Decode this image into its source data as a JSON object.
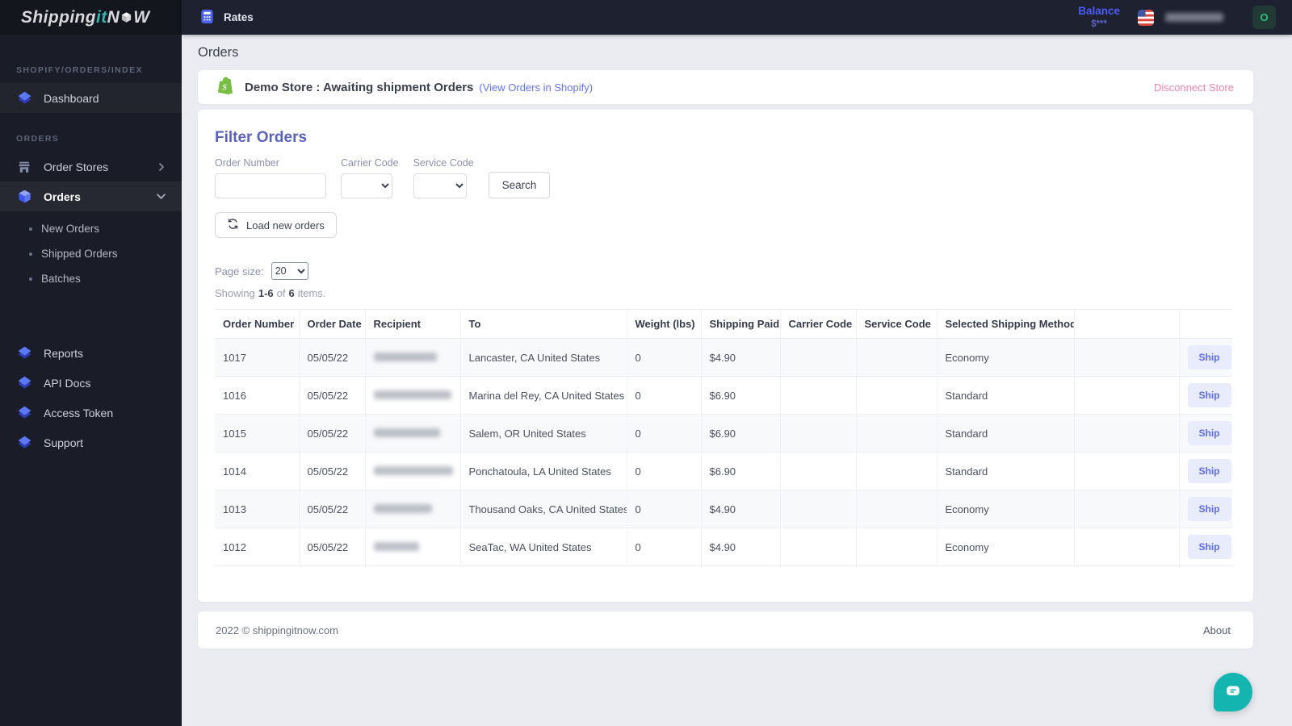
{
  "sidebar": {
    "logo": {
      "part1": "Shipping",
      "part2": "it",
      "part3": "N",
      "part4": "W"
    },
    "section_shopify": "SHOPIFY/ORDERS/INDEX",
    "dashboard": "Dashboard",
    "section_orders": "ORDERS",
    "order_stores": "Order Stores",
    "orders": "Orders",
    "sub_items": [
      "New Orders",
      "Shipped Orders",
      "Batches"
    ],
    "reports": "Reports",
    "api_docs": "API Docs",
    "access_token": "Access Token",
    "support": "Support"
  },
  "topbar": {
    "nav_rates": "Rates",
    "balance_label": "Balance",
    "balance_value": "$***",
    "avatar_initial": "O"
  },
  "page": {
    "title": "Orders"
  },
  "store_banner": {
    "title": "Demo Store : Awaiting shipment Orders",
    "link": "(View Orders in Shopify)",
    "disconnect": "Disconnect Store"
  },
  "filters": {
    "heading": "Filter Orders",
    "order_number_label": "Order Number",
    "carrier_code_label": "Carrier Code",
    "service_code_label": "Service Code",
    "search_button": "Search",
    "load_button": "Load new orders"
  },
  "pagination": {
    "page_size_label": "Page size:",
    "page_size_value": "20",
    "showing_prefix": "Showing",
    "range": "1-6",
    "of": "of",
    "total": "6",
    "items_suffix": "items."
  },
  "table": {
    "headers": [
      "Order Number",
      "Order Date",
      "Recipient",
      "To",
      "Weight (lbs)",
      "Shipping Paid",
      "Carrier Code",
      "Service Code",
      "Selected Shipping Method",
      "",
      ""
    ],
    "ship_label": "Ship",
    "rows": [
      {
        "order_number": "1017",
        "order_date": "05/05/22",
        "to": "Lancaster, CA United States",
        "weight": "0",
        "shipping_paid": "$4.90",
        "carrier_code": "",
        "service_code": "",
        "method": "Economy"
      },
      {
        "order_number": "1016",
        "order_date": "05/05/22",
        "to": "Marina del Rey, CA United States",
        "weight": "0",
        "shipping_paid": "$6.90",
        "carrier_code": "",
        "service_code": "",
        "method": "Standard"
      },
      {
        "order_number": "1015",
        "order_date": "05/05/22",
        "to": "Salem, OR United States",
        "weight": "0",
        "shipping_paid": "$6.90",
        "carrier_code": "",
        "service_code": "",
        "method": "Standard"
      },
      {
        "order_number": "1014",
        "order_date": "05/05/22",
        "to": "Ponchatoula, LA United States",
        "weight": "0",
        "shipping_paid": "$6.90",
        "carrier_code": "",
        "service_code": "",
        "method": "Standard"
      },
      {
        "order_number": "1013",
        "order_date": "05/05/22",
        "to": "Thousand Oaks, CA United States",
        "weight": "0",
        "shipping_paid": "$4.90",
        "carrier_code": "",
        "service_code": "",
        "method": "Economy"
      },
      {
        "order_number": "1012",
        "order_date": "05/05/22",
        "to": "SeaTac, WA United States",
        "weight": "0",
        "shipping_paid": "$4.90",
        "carrier_code": "",
        "service_code": "",
        "method": "Economy"
      }
    ]
  },
  "footer": {
    "copyright": "2022 © shippingitnow.com",
    "about": "About"
  },
  "colors": {
    "accent_purple": "#5a63b8",
    "link_blue": "#6473f0",
    "balance_blue": "#4c5cf5",
    "disconnect_pink": "#f486ac",
    "ship_button_text": "#5b6af0",
    "ship_button_bg": "#e9ecfc",
    "shopify_green": "#77bf44",
    "avatar_green": "#27c281",
    "chat_teal": "#14b5b0",
    "sidebar_bg": "#1a1d27",
    "topbar_bg": "#1d2130",
    "logo_teal": "#35b5ae"
  }
}
